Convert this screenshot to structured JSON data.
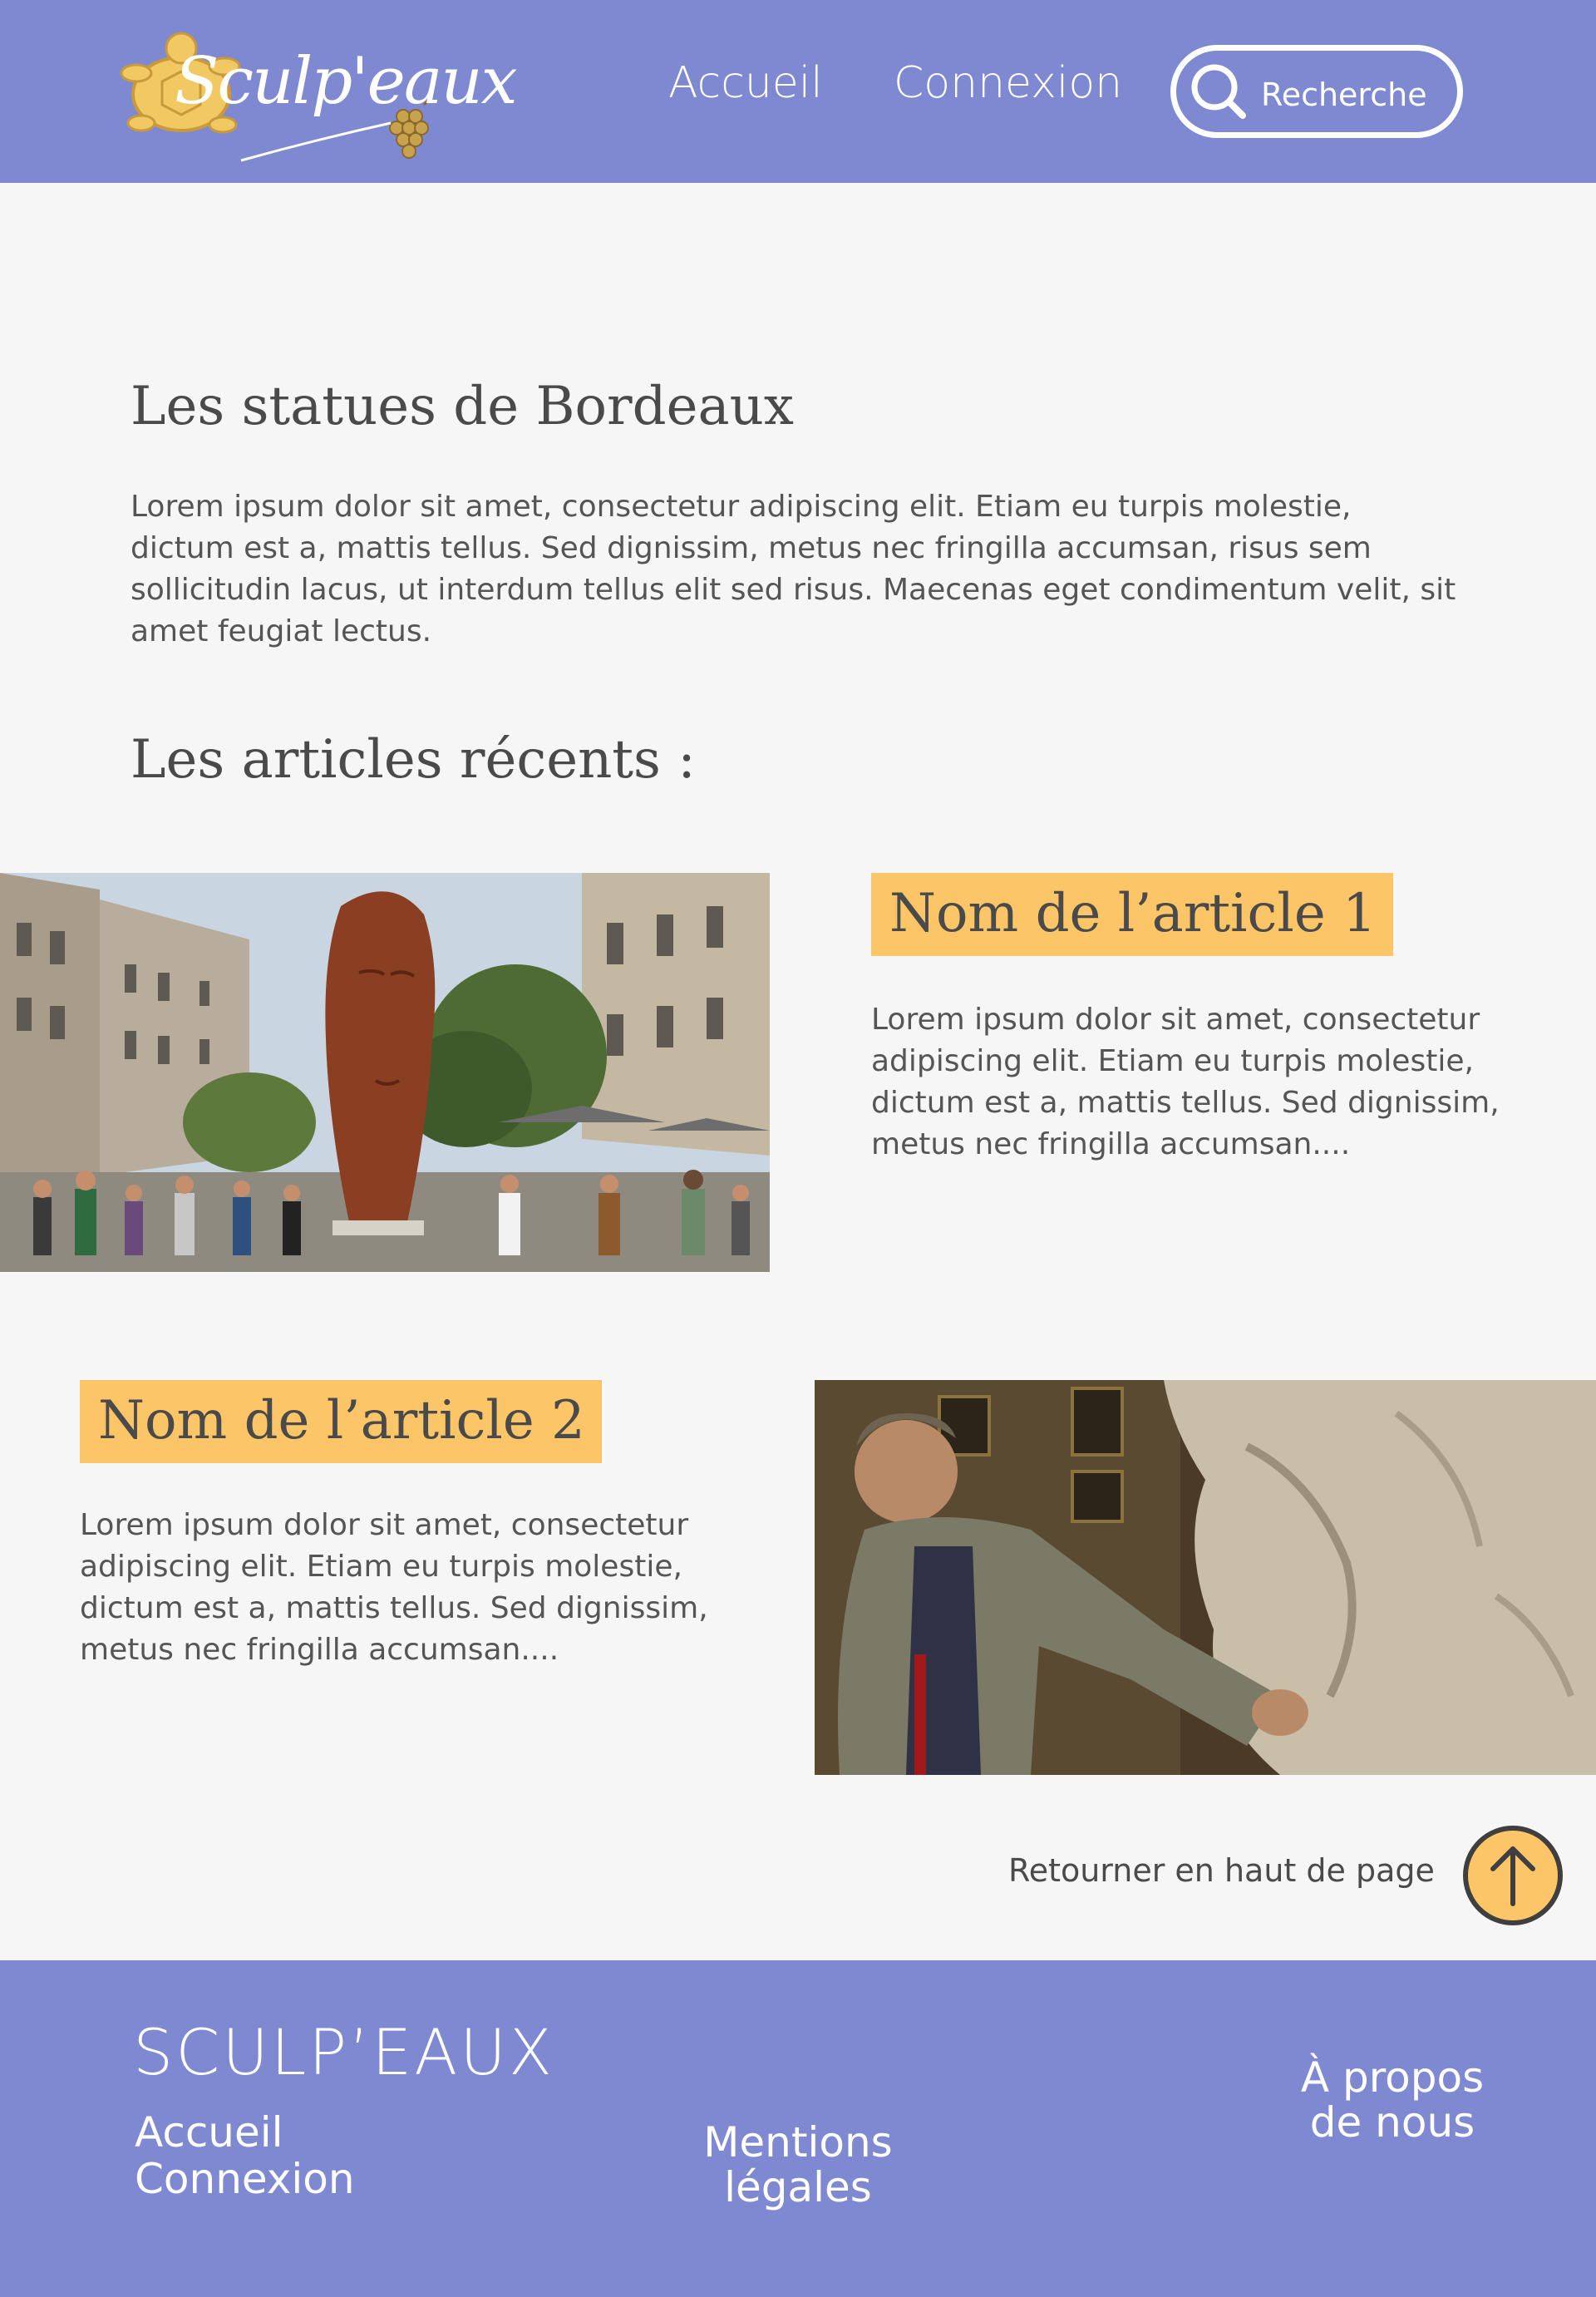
{
  "header": {
    "logo_text": "Sculp'eaux",
    "nav": {
      "home": "Accueil",
      "login": "Connexion"
    },
    "search_placeholder": "Recherche"
  },
  "main": {
    "title": "Les statues de Bordeaux",
    "intro": "Lorem ipsum dolor sit amet, consectetur adipiscing elit. Etiam eu turpis molestie, dictum est a, mattis tellus. Sed dignissim, metus nec fringilla accumsan, risus sem sollicitudin lacus, ut interdum tellus elit sed risus. Maecenas eget condimentum velit, sit amet feugiat lectus.",
    "recent_heading": "Les articles récents :",
    "articles": [
      {
        "title": "Nom de l’article 1",
        "excerpt": "Lorem ipsum dolor sit amet, consectetur adipiscing elit. Etiam eu turpis molestie, dictum est a, mattis tellus. Sed dignissim, metus nec fringilla accumsan...."
      },
      {
        "title": "Nom de l’article 2",
        "excerpt": "Lorem ipsum dolor sit amet, consectetur adipiscing elit. Etiam eu turpis molestie, dictum est a, mattis tellus. Sed dignissim, metus nec fringilla accumsan...."
      }
    ],
    "back_to_top": "Retourner en haut de page"
  },
  "footer": {
    "brand": "SCULP’EAUX",
    "home": "Accueil",
    "login": "Connexion",
    "legal": "Mentions légales",
    "about": "À propos de nous"
  },
  "colors": {
    "header_bg": "#7f89d1",
    "accent": "#fcc668",
    "page_bg": "#f6f6f6",
    "text": "#4a4a4a"
  },
  "icons": {
    "search": "search-icon",
    "back_to_top": "arrow-up-icon",
    "logo": "turtle-logo-icon"
  }
}
